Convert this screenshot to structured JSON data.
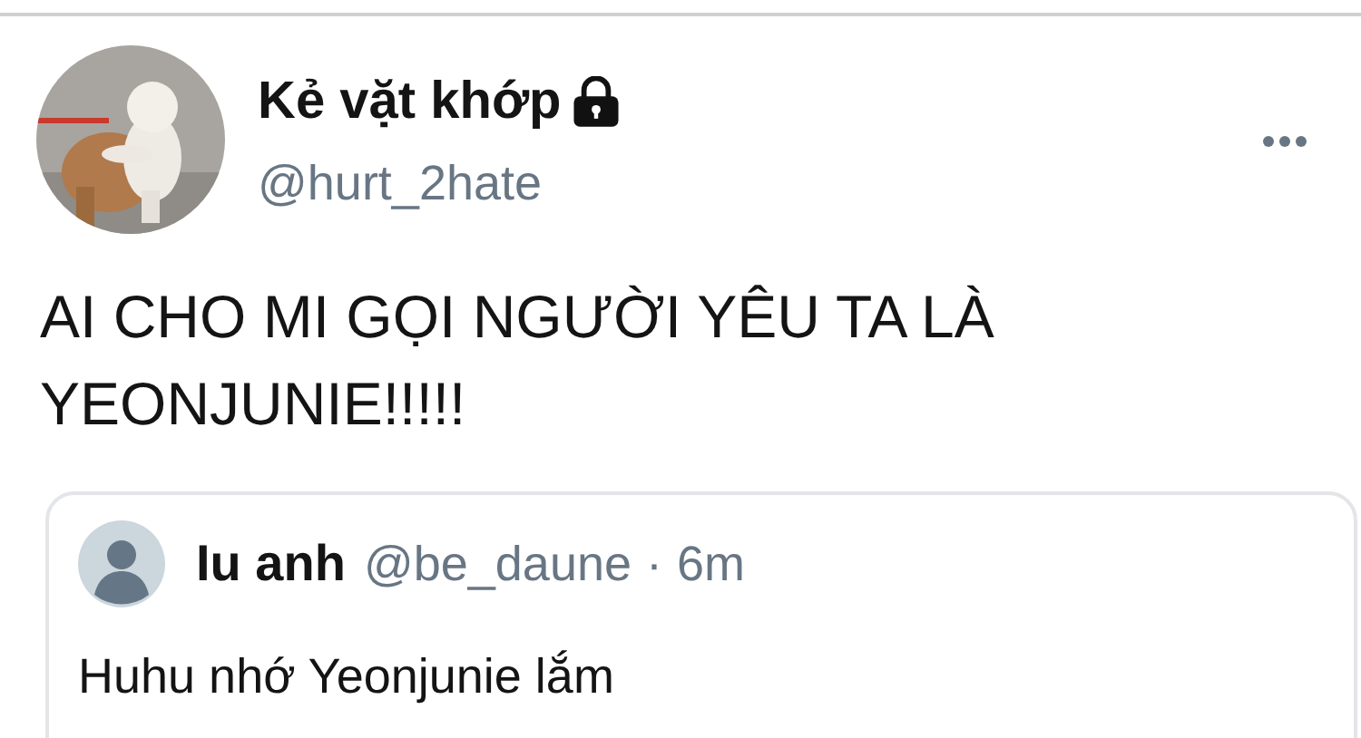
{
  "tweet": {
    "author": {
      "name": "Kẻ vặt khớp",
      "protected": true,
      "handle": "@hurt_2hate"
    },
    "text_lines": [
      "AI CHO MI GỌI NGƯỜI YÊU TA LÀ",
      "YEONJUNIE!!!!!"
    ],
    "quoted": {
      "name": "Iu anh",
      "handle": "@be_daune",
      "separator": "·",
      "time": "6m",
      "text": "Huhu nhớ Yeonjunie lắm"
    }
  }
}
